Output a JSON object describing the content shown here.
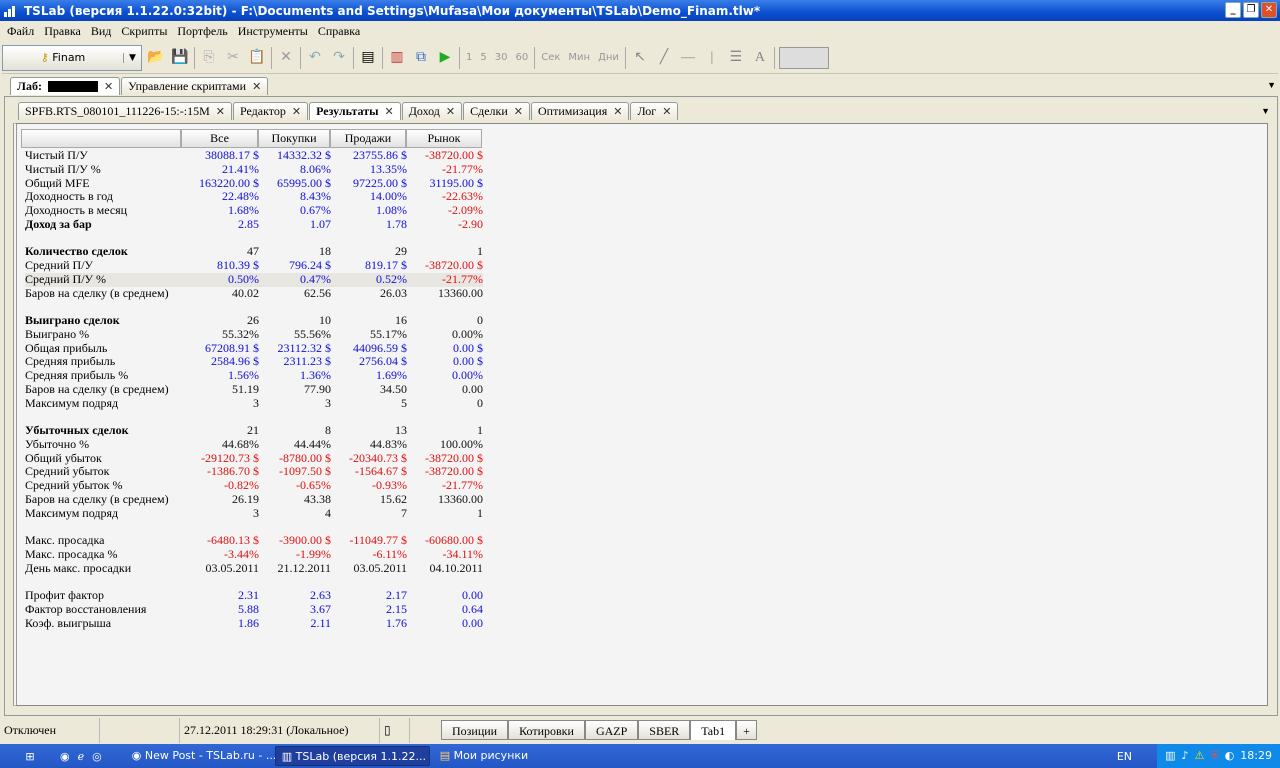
{
  "window": {
    "title": "TSLab (версия 1.1.22.0:32bit) - F:\\Documents and Settings\\Mufasa\\Мои документы\\TSLab\\Demo_Finam.tlw*"
  },
  "menu": [
    "Файл",
    "Правка",
    "Вид",
    "Скрипты",
    "Портфель",
    "Инструменты",
    "Справка"
  ],
  "toolbar": {
    "provider": "Finam",
    "intervals": [
      "1",
      "5",
      "30",
      "60"
    ],
    "units": [
      "Сек",
      "Мин",
      "Дни"
    ]
  },
  "lab_tabs": [
    {
      "label": "Лаб:"
    },
    {
      "label": "Управление скриптами"
    }
  ],
  "inner_tabs": [
    "SPFB.RTS_080101_111226-15:-:15M",
    "Редактор",
    "Результаты",
    "Доход",
    "Сделки",
    "Оптимизация",
    "Лог"
  ],
  "active_inner_tab": 2,
  "table": {
    "headers": [
      "Все",
      "Покупки",
      "Продажи",
      "Рынок"
    ],
    "rows": [
      {
        "label": "Чистый П/У",
        "values": [
          "38088.17 $",
          "14332.32 $",
          "23755.86 $",
          "-38720.00 $"
        ],
        "colors": [
          "b",
          "b",
          "b",
          "r"
        ]
      },
      {
        "label": "Чистый П/У %",
        "values": [
          "21.41%",
          "8.06%",
          "13.35%",
          "-21.77%"
        ],
        "colors": [
          "b",
          "b",
          "b",
          "r"
        ]
      },
      {
        "label": "Общий MFE",
        "values": [
          "163220.00 $",
          "65995.00 $",
          "97225.00 $",
          "31195.00 $"
        ],
        "colors": [
          "b",
          "b",
          "b",
          "b"
        ]
      },
      {
        "label": "Доходность в год",
        "values": [
          "22.48%",
          "8.43%",
          "14.00%",
          "-22.63%"
        ],
        "colors": [
          "b",
          "b",
          "b",
          "r"
        ]
      },
      {
        "label": "Доходность в месяц",
        "values": [
          "1.68%",
          "0.67%",
          "1.08%",
          "-2.09%"
        ],
        "colors": [
          "b",
          "b",
          "b",
          "r"
        ]
      },
      {
        "label": "Доход за бар",
        "bold": true,
        "values": [
          "2.85",
          "1.07",
          "1.78",
          "-2.90"
        ],
        "colors": [
          "b",
          "b",
          "b",
          "r"
        ]
      },
      {
        "blank": true
      },
      {
        "label": "Количество сделок",
        "bold": true,
        "values": [
          "47",
          "18",
          "29",
          "1"
        ],
        "colors": [
          "k",
          "k",
          "k",
          "k"
        ]
      },
      {
        "label": "Средний П/У",
        "values": [
          "810.39 $",
          "796.24 $",
          "819.17 $",
          "-38720.00 $"
        ],
        "colors": [
          "b",
          "b",
          "b",
          "r"
        ]
      },
      {
        "label": "Средний П/У %",
        "highlight": true,
        "values": [
          "0.50%",
          "0.47%",
          "0.52%",
          "-21.77%"
        ],
        "colors": [
          "b",
          "b",
          "b",
          "r"
        ]
      },
      {
        "label": "Баров на сделку (в среднем)",
        "values": [
          "40.02",
          "62.56",
          "26.03",
          "13360.00"
        ],
        "colors": [
          "k",
          "k",
          "k",
          "k"
        ]
      },
      {
        "blank": true
      },
      {
        "label": "Выиграно сделок",
        "bold": true,
        "values": [
          "26",
          "10",
          "16",
          "0"
        ],
        "colors": [
          "k",
          "k",
          "k",
          "k"
        ]
      },
      {
        "label": "Выиграно %",
        "values": [
          "55.32%",
          "55.56%",
          "55.17%",
          "0.00%"
        ],
        "colors": [
          "k",
          "k",
          "k",
          "k"
        ]
      },
      {
        "label": "Общая прибыль",
        "values": [
          "67208.91 $",
          "23112.32 $",
          "44096.59 $",
          "0.00 $"
        ],
        "colors": [
          "b",
          "b",
          "b",
          "b"
        ]
      },
      {
        "label": "Средняя прибыль",
        "values": [
          "2584.96 $",
          "2311.23 $",
          "2756.04 $",
          "0.00 $"
        ],
        "colors": [
          "b",
          "b",
          "b",
          "b"
        ]
      },
      {
        "label": "Средняя прибыль %",
        "values": [
          "1.56%",
          "1.36%",
          "1.69%",
          "0.00%"
        ],
        "colors": [
          "b",
          "b",
          "b",
          "b"
        ]
      },
      {
        "label": "Баров на сделку (в среднем)",
        "values": [
          "51.19",
          "77.90",
          "34.50",
          "0.00"
        ],
        "colors": [
          "k",
          "k",
          "k",
          "k"
        ]
      },
      {
        "label": "Максимум подряд",
        "values": [
          "3",
          "3",
          "5",
          "0"
        ],
        "colors": [
          "k",
          "k",
          "k",
          "k"
        ]
      },
      {
        "blank": true
      },
      {
        "label": "Убыточных сделок",
        "bold": true,
        "values": [
          "21",
          "8",
          "13",
          "1"
        ],
        "colors": [
          "k",
          "k",
          "k",
          "k"
        ]
      },
      {
        "label": "Убыточно %",
        "values": [
          "44.68%",
          "44.44%",
          "44.83%",
          "100.00%"
        ],
        "colors": [
          "k",
          "k",
          "k",
          "k"
        ]
      },
      {
        "label": "Общий убыток",
        "values": [
          "-29120.73 $",
          "-8780.00 $",
          "-20340.73 $",
          "-38720.00 $"
        ],
        "colors": [
          "r",
          "r",
          "r",
          "r"
        ]
      },
      {
        "label": "Средний убыток",
        "values": [
          "-1386.70 $",
          "-1097.50 $",
          "-1564.67 $",
          "-38720.00 $"
        ],
        "colors": [
          "r",
          "r",
          "r",
          "r"
        ]
      },
      {
        "label": "Средний убыток %",
        "values": [
          "-0.82%",
          "-0.65%",
          "-0.93%",
          "-21.77%"
        ],
        "colors": [
          "r",
          "r",
          "r",
          "r"
        ]
      },
      {
        "label": "Баров на сделку (в среднем)",
        "values": [
          "26.19",
          "43.38",
          "15.62",
          "13360.00"
        ],
        "colors": [
          "k",
          "k",
          "k",
          "k"
        ]
      },
      {
        "label": "Максимум подряд",
        "values": [
          "3",
          "4",
          "7",
          "1"
        ],
        "colors": [
          "k",
          "k",
          "k",
          "k"
        ]
      },
      {
        "blank": true
      },
      {
        "label": "Макс. просадка",
        "values": [
          "-6480.13 $",
          "-3900.00 $",
          "-11049.77 $",
          "-60680.00 $"
        ],
        "colors": [
          "r",
          "r",
          "r",
          "r"
        ]
      },
      {
        "label": "Макс. просадка %",
        "values": [
          "-3.44%",
          "-1.99%",
          "-6.11%",
          "-34.11%"
        ],
        "colors": [
          "r",
          "r",
          "r",
          "r"
        ]
      },
      {
        "label": "День макс. просадки",
        "values": [
          "03.05.2011",
          "21.12.2011",
          "03.05.2011",
          "04.10.2011"
        ],
        "colors": [
          "k",
          "k",
          "k",
          "k"
        ]
      },
      {
        "blank": true
      },
      {
        "label": "Профит фактор",
        "values": [
          "2.31",
          "2.63",
          "2.17",
          "0.00"
        ],
        "colors": [
          "b",
          "b",
          "b",
          "b"
        ]
      },
      {
        "label": "Фактор восстановления",
        "values": [
          "5.88",
          "3.67",
          "2.15",
          "0.64"
        ],
        "colors": [
          "b",
          "b",
          "b",
          "b"
        ]
      },
      {
        "label": "Коэф. выигрыша",
        "values": [
          "1.86",
          "2.11",
          "1.76",
          "0.00"
        ],
        "colors": [
          "b",
          "b",
          "b",
          "b"
        ]
      }
    ]
  },
  "status": {
    "connection": "Отключен",
    "datetime": "27.12.2011 18:29:31 (Локальное)"
  },
  "bottom_tabs": [
    "Позиции",
    "Котировки",
    "GAZP",
    "SBER",
    "Tab1",
    "+"
  ],
  "taskbar": {
    "tasks": [
      "New Post - TSLab.ru - ...",
      "TSLab (версия 1.1.22...",
      "Мои рисунки"
    ],
    "lang": "EN",
    "clock": "18:29"
  }
}
